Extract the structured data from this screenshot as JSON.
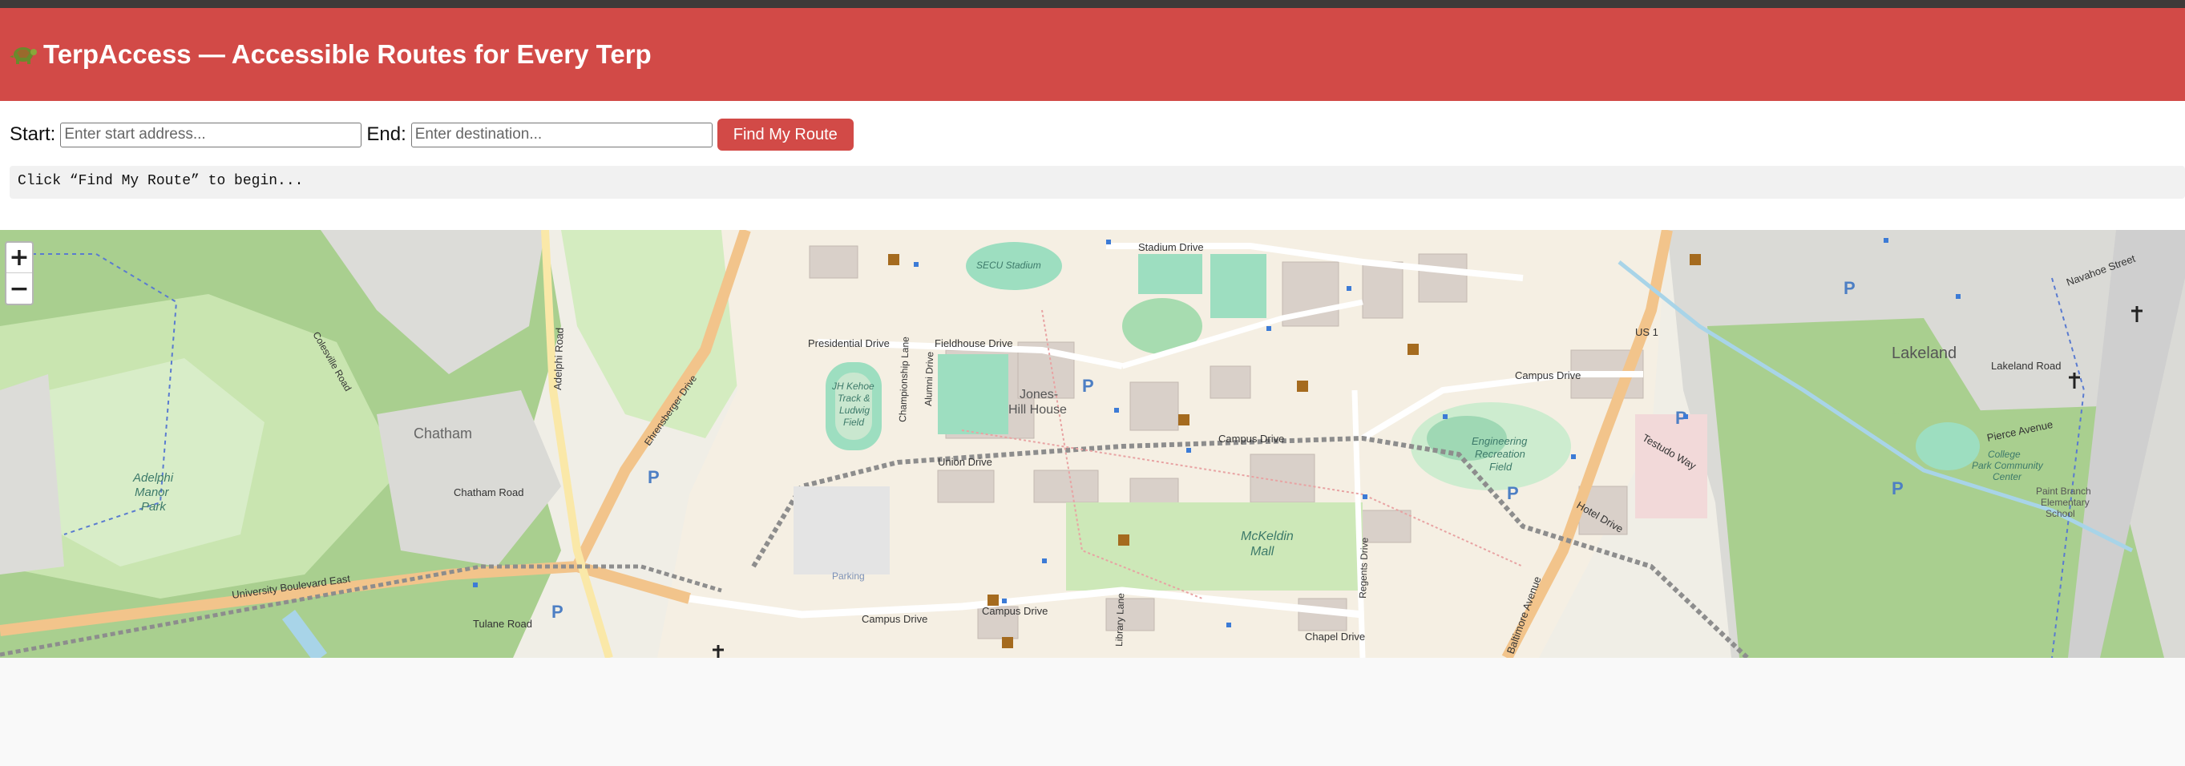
{
  "header": {
    "title": "TerpAccess — Accessible Routes for Every Terp"
  },
  "form": {
    "start_label": "Start:",
    "start_placeholder": "Enter start address...",
    "end_label": "End:",
    "end_placeholder": "Enter destination...",
    "button_label": "Find My Route"
  },
  "status": {
    "message": "Click “Find My Route” to begin..."
  },
  "map": {
    "zoom_in": "+",
    "zoom_out": "−",
    "labels": {
      "stadium_drive": "Stadium Drive",
      "secu_stadium": "SECU Stadium",
      "presidential_drive": "Presidential Drive",
      "fieldhouse_drive": "Fieldhouse Drive",
      "jones_hill_1": "Jones-",
      "jones_hill_2": "Hill House",
      "kehoe_1": "JH Kehoe",
      "kehoe_2": "Track &",
      "kehoe_3": "Ludwig",
      "kehoe_4": "Field",
      "campus_drive": "Campus Drive",
      "mckeldin_1": "McKeldin",
      "mckeldin_2": "Mall",
      "chatham": "Chatham",
      "chatham_road": "Chatham Road",
      "adelphi_1": "Adelphi",
      "adelphi_2": "Manor",
      "adelphi_3": "Park",
      "adelphi_road": "Adelphi Road",
      "university_blvd": "University Boulevard East",
      "lakeland": "Lakeland",
      "engineering_1": "Engineering",
      "engineering_2": "Recreation",
      "engineering_3": "Field",
      "baltimore_avenue": "Baltimore Avenue",
      "us1": "US 1",
      "cpcc_1": "College",
      "cpcc_2": "Park Community",
      "cpcc_3": "Center",
      "paint_branch_1": "Paint Branch",
      "paint_branch_2": "Elementary",
      "paint_branch_3": "School",
      "chapel_drive": "Chapel Drive",
      "regents_drive": "Regents Drive",
      "library_lane": "Library Lane",
      "alumni_drive": "Alumni Drive",
      "championship_lane": "Championship Lane",
      "tulane_road": "Tulane Road",
      "lakeland_road": "Lakeland Road",
      "pierce_avenue": "Pierce Avenue",
      "navahoe_street": "Navahoe Street",
      "testudo_way": "Testudo Way",
      "hotel_drive": "Hotel Drive",
      "ehrensberger": "Ehrensberger Drive",
      "parking": "Parking",
      "union_drive": "Union Drive",
      "colesville": "Colesville Road",
      "p": "P"
    }
  },
  "colors": {
    "header_bg": "#d24a47",
    "button_bg": "#d24a47"
  }
}
